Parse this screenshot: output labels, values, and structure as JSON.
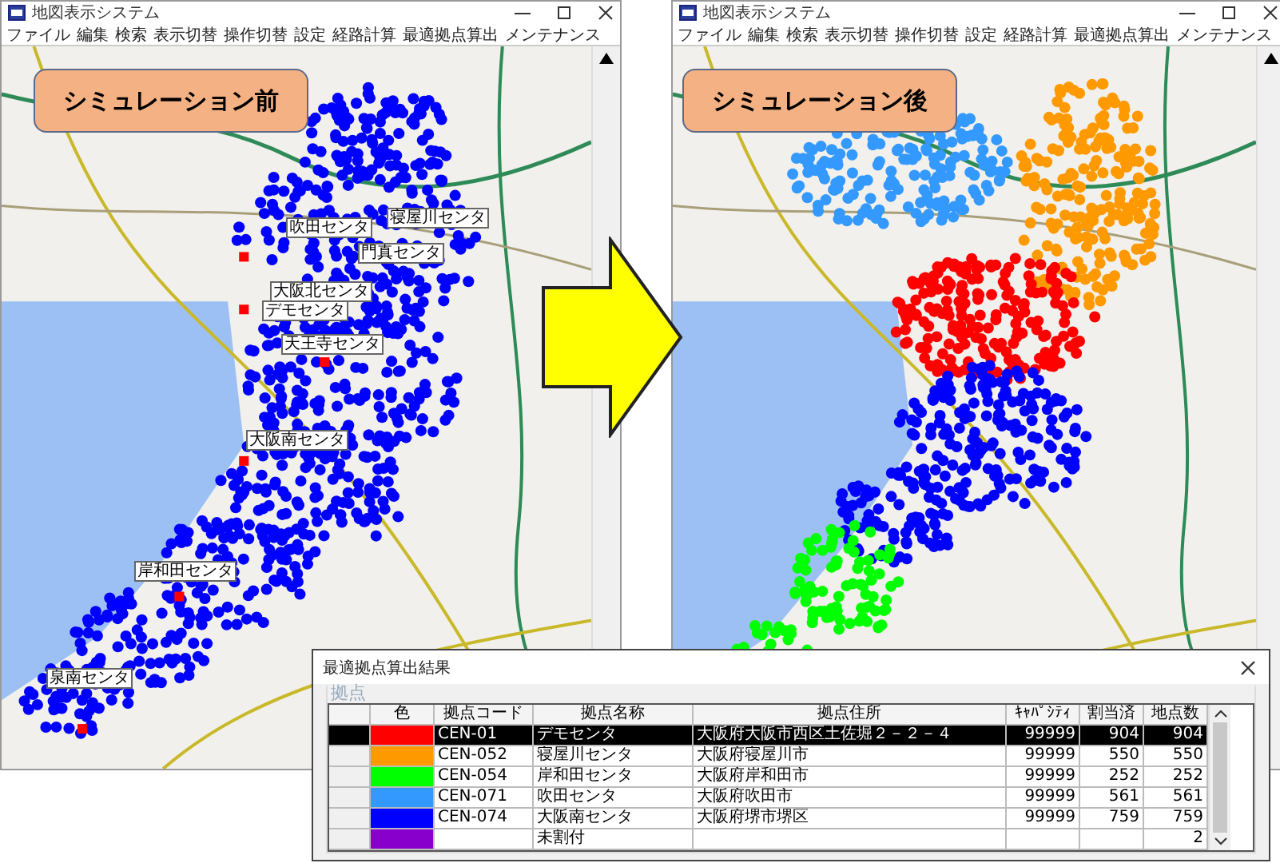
{
  "windows": [
    {
      "kind": "before",
      "title": "地図表示システム",
      "menu": [
        "ファイル",
        "編集",
        "検索",
        "表示切替",
        "操作切替",
        "設定",
        "経路計算",
        "最適拠点算出",
        "メンテナンス"
      ],
      "banner": "シミュレーション前",
      "center_labels": [
        "吹田センタ",
        "寝屋川センタ",
        "門真センタ",
        "大阪北センタ",
        "デモセンタ",
        "天王寺センタ",
        "大阪南センタ",
        "岸和田センタ",
        "泉南センタ"
      ]
    },
    {
      "kind": "after",
      "title": "地図表示システム",
      "menu": [
        "ファイル",
        "編集",
        "検索",
        "表示切替",
        "操作切替",
        "設定",
        "経路計算",
        "最適拠点算出",
        "メンテナンス"
      ],
      "banner": "シミュレーション後"
    }
  ],
  "dialog": {
    "title": "最適拠点算出結果",
    "group": "拠点",
    "columns": [
      "色",
      "拠点コード",
      "拠点名称",
      "拠点住所",
      "ｷｬﾊﾟｼﾃｨ",
      "割当済",
      "地点数"
    ],
    "rows": [
      {
        "color": "#ff0000",
        "code": "CEN-01",
        "name": "デモセンタ",
        "address": "大阪府大阪市西区土佐堀２－２－４",
        "capacity": "99999",
        "assigned": "904",
        "points": "904",
        "selected": true
      },
      {
        "color": "#ff9900",
        "code": "CEN-052",
        "name": "寝屋川センタ",
        "address": "大阪府寝屋川市",
        "capacity": "99999",
        "assigned": "550",
        "points": "550",
        "selected": false
      },
      {
        "color": "#00ff00",
        "code": "CEN-054",
        "name": "岸和田センタ",
        "address": "大阪府岸和田市",
        "capacity": "99999",
        "assigned": "252",
        "points": "252",
        "selected": false
      },
      {
        "color": "#3399ff",
        "code": "CEN-071",
        "name": "吹田センタ",
        "address": "大阪府吹田市",
        "capacity": "99999",
        "assigned": "561",
        "points": "561",
        "selected": false
      },
      {
        "color": "#0000ff",
        "code": "CEN-074",
        "name": "大阪南センタ",
        "address": "大阪府堺市堺区",
        "capacity": "99999",
        "assigned": "759",
        "points": "759",
        "selected": false
      },
      {
        "color": "#8800cc",
        "code": "",
        "name": "未割付",
        "address": "",
        "capacity": "",
        "assigned": "",
        "points": "2",
        "selected": false
      }
    ]
  }
}
